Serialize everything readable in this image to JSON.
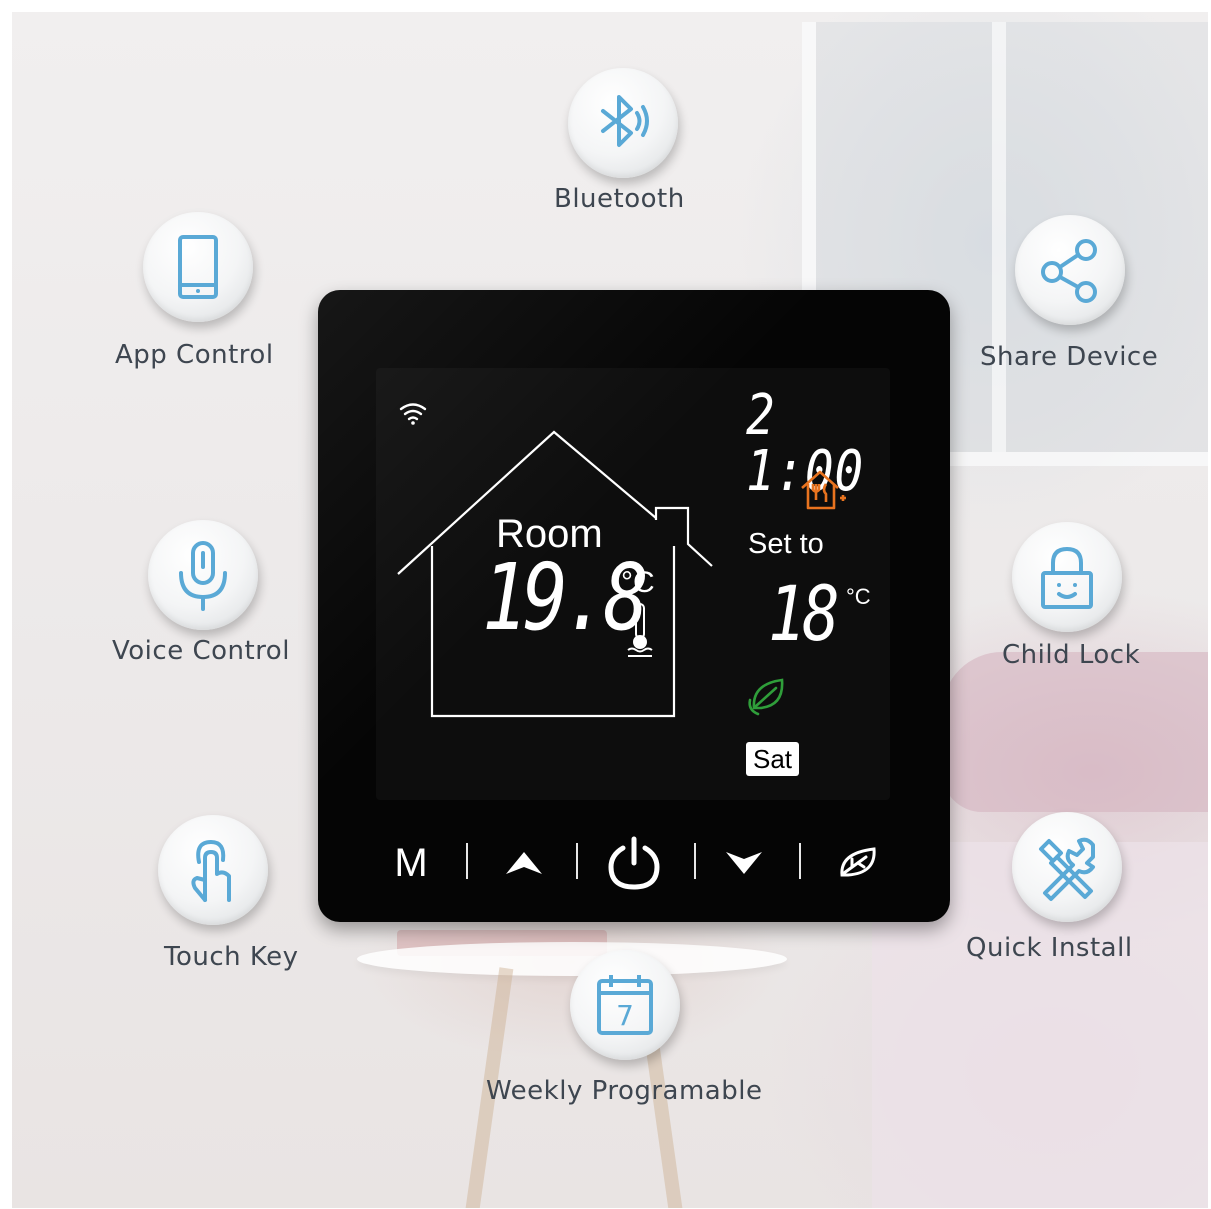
{
  "features": [
    {
      "id": "bluetooth",
      "label": "Bluetooth",
      "icon": "bluetooth-icon"
    },
    {
      "id": "app-control",
      "label": "App Control",
      "icon": "smartphone-icon"
    },
    {
      "id": "share-device",
      "label": "Share Device",
      "icon": "share-icon"
    },
    {
      "id": "voice-control",
      "label": "Voice Control",
      "icon": "microphone-icon"
    },
    {
      "id": "child-lock",
      "label": "Child Lock",
      "icon": "lock-icon"
    },
    {
      "id": "touch-key",
      "label": "Touch Key",
      "icon": "touch-hand-icon"
    },
    {
      "id": "quick-install",
      "label": "Quick Install",
      "icon": "tools-icon"
    },
    {
      "id": "weekly",
      "label": "Weekly Programable",
      "icon": "calendar-icon",
      "calendar_day": "7"
    }
  ],
  "thermostat": {
    "time": "21:00",
    "room_label": "Room",
    "room_temp": "19.8",
    "unit": "°C",
    "set_label": "Set to",
    "set_temp": "18",
    "day": "Sat",
    "keys": {
      "mode": "M",
      "up_icon": "arrow-up-icon",
      "power_icon": "power-icon",
      "down_icon": "arrow-down-icon",
      "eco_icon": "leaf-icon"
    }
  },
  "colors": {
    "icon_blue": "#5aa9d6",
    "label_text": "#3e4650",
    "device_bg": "#050505",
    "mode_orange": "#e8731f",
    "eco_green": "#2f9e3a"
  }
}
